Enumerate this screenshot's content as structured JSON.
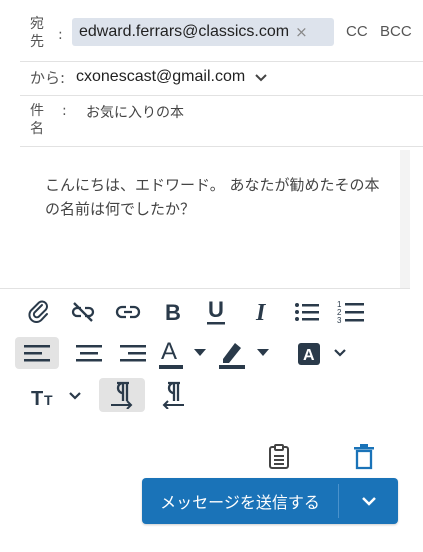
{
  "header": {
    "to_label": "宛\n先",
    "to_label_1": "宛",
    "to_label_2": "先",
    "colon": ":",
    "recipient": "edward.ferrars@classics.com",
    "remove_glyph": "×",
    "cc_label": "CC",
    "bcc_label": "BCC",
    "from_label": "から:",
    "from_value": "cxonescast@gmail.com",
    "subject_label_1": "件",
    "subject_label_2": "名",
    "subject_colon": ":",
    "subject_value": "お気に入りの本"
  },
  "body": {
    "text": "こんにちは、エドワード。 あなたが勧めたその本の名前は何でしたか？"
  },
  "toolbar": {
    "icons": [
      "paperclip-icon",
      "unlink-icon",
      "link-icon",
      "bold-icon",
      "underline-icon",
      "italic-icon",
      "bulleted-list-icon",
      "numbered-list-icon",
      "align-left-icon",
      "align-center-icon",
      "align-right-icon",
      "font-color-icon",
      "highlight-color-icon",
      "text-background-icon",
      "font-size-icon",
      "ltr-direction-icon",
      "rtl-direction-icon"
    ],
    "selected": [
      "align-left",
      "ltr-direction"
    ]
  },
  "footer": {
    "send_label": "メッセージを送信する",
    "accent_color": "#1a73b8"
  }
}
